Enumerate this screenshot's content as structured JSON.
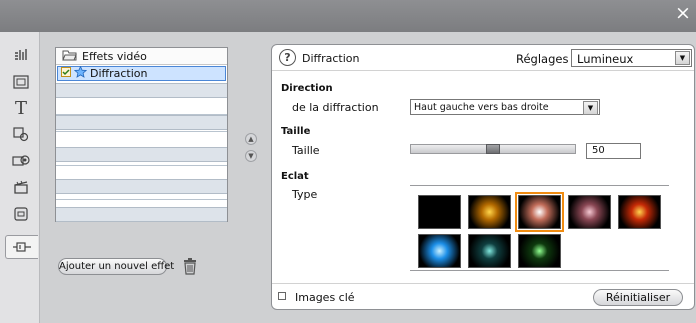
{
  "window": {
    "close_glyph": "×",
    "close_icon": "close-icon"
  },
  "sidebar": {
    "tools": [
      {
        "name": "tool-audio-icon",
        "active": false
      },
      {
        "name": "tool-image-icon",
        "active": false
      },
      {
        "name": "tool-title-icon",
        "glyph": "T",
        "active": false
      },
      {
        "name": "tool-audio-effects-icon",
        "active": false
      },
      {
        "name": "tool-camera-icon",
        "active": false
      },
      {
        "name": "tool-clapperboard-icon",
        "active": false
      },
      {
        "name": "tool-square-icon",
        "active": false
      },
      {
        "name": "tool-video-effects-icon",
        "active": true
      }
    ]
  },
  "effects_list": {
    "header": "Effets vidéo",
    "header_icon": "folder-icon",
    "items": [
      {
        "label": "Diffraction",
        "icon": "star-icon",
        "enabled_icon": "fx-enabled-icon",
        "selected": true
      }
    ],
    "add_button": "Ajouter un nouvel effet",
    "trash_icon": "trash-icon",
    "move_up_icon": "arrow-up-icon",
    "move_down_icon": "arrow-down-icon"
  },
  "effect_panel": {
    "help_glyph": "?",
    "title": "Diffraction",
    "presets_label": "Réglages :",
    "presets_value": "Lumineux",
    "direction": {
      "section": "Direction",
      "label": "de la diffraction",
      "value": "Haut gauche vers bas droite"
    },
    "size": {
      "section": "Taille",
      "label": "Taille",
      "value": "50",
      "fraction": 0.5
    },
    "flare": {
      "section": "Eclat",
      "label": "Type",
      "swatches": [
        {
          "name": "flare-black",
          "color": "#000000",
          "glow": "#000000",
          "selected": false
        },
        {
          "name": "flare-gold",
          "color": "#ffd54a",
          "glow": "#b46a00",
          "selected": false
        },
        {
          "name": "flare-white",
          "color": "#ffffff",
          "glow": "#c26d5a",
          "selected": true
        },
        {
          "name": "flare-pink",
          "color": "#f5c8d2",
          "glow": "#8a4754",
          "selected": false
        },
        {
          "name": "flare-red",
          "color": "#ffd24d",
          "glow": "#c62a06",
          "selected": false
        },
        {
          "name": "flare-blue",
          "color": "#c9f0ff",
          "glow": "#1c8fe8",
          "selected": false
        },
        {
          "name": "flare-teal",
          "color": "#7fe6dd",
          "glow": "#0f3f40",
          "selected": false
        },
        {
          "name": "flare-green",
          "color": "#8fff8f",
          "glow": "#0e3a0e",
          "selected": false
        }
      ]
    },
    "keyframes_label": "Images clé",
    "reset_button": "Réinitialiser"
  }
}
